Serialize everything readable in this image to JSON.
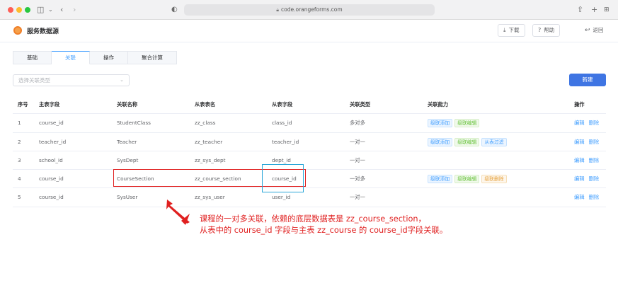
{
  "browser": {
    "url": "code.orangeforms.com"
  },
  "header": {
    "title": "服务数据源",
    "download_label": "下载",
    "help_label": "帮助",
    "back_label": "返回"
  },
  "tabs": [
    {
      "label": "基础",
      "active": false
    },
    {
      "label": "关联",
      "active": true
    },
    {
      "label": "操作",
      "active": false
    },
    {
      "label": "聚合计算",
      "active": false
    }
  ],
  "filter": {
    "placeholder": "选择关联类型"
  },
  "new_button_label": "新建",
  "table": {
    "columns": [
      "序号",
      "主表字段",
      "关联名称",
      "从表表名",
      "从表字段",
      "关联类型",
      "关联能力",
      "操作"
    ],
    "rows": [
      {
        "index": "1",
        "master_field": "course_id",
        "relation_name": "StudentClass",
        "slave_table": "zz_class",
        "slave_field": "class_id",
        "relation_type": "多对多",
        "abilities": [
          {
            "label": "级联添加",
            "color": "blue"
          },
          {
            "label": "级联编辑",
            "color": "green"
          }
        ],
        "edit": "编辑",
        "delete": "删除"
      },
      {
        "index": "2",
        "master_field": "teacher_id",
        "relation_name": "Teacher",
        "slave_table": "zz_teacher",
        "slave_field": "teacher_id",
        "relation_type": "一对一",
        "abilities": [
          {
            "label": "级联添加",
            "color": "blue"
          },
          {
            "label": "级联编辑",
            "color": "green"
          },
          {
            "label": "从表过滤",
            "color": "blue"
          }
        ],
        "edit": "编辑",
        "delete": "删除"
      },
      {
        "index": "3",
        "master_field": "school_id",
        "relation_name": "SysDept",
        "slave_table": "zz_sys_dept",
        "slave_field": "dept_id",
        "relation_type": "一对一",
        "abilities": [],
        "edit": "编辑",
        "delete": "删除"
      },
      {
        "index": "4",
        "master_field": "course_id",
        "relation_name": "CourseSection",
        "slave_table": "zz_course_section",
        "slave_field": "course_id",
        "relation_type": "一对多",
        "abilities": [
          {
            "label": "级联添加",
            "color": "blue"
          },
          {
            "label": "级联编辑",
            "color": "green"
          },
          {
            "label": "级联删除",
            "color": "orange"
          }
        ],
        "edit": "编辑",
        "delete": "删除"
      },
      {
        "index": "5",
        "master_field": "course_id",
        "relation_name": "SysUser",
        "slave_table": "zz_sys_user",
        "slave_field": "user_id",
        "relation_type": "一对一",
        "abilities": [],
        "edit": "编辑",
        "delete": "删除"
      }
    ]
  },
  "annotation": {
    "line1": "课程的一对多关联，依赖的底层数据表是 zz_course_section，",
    "line2": "从表中的 course_id 字段与主表 zz_course 的 course_id字段关联。"
  },
  "colors": {
    "primary": "#409eff",
    "new_button": "#3f75e3",
    "annotation": "#e02020",
    "highlight_blue": "#2aa6d8"
  }
}
